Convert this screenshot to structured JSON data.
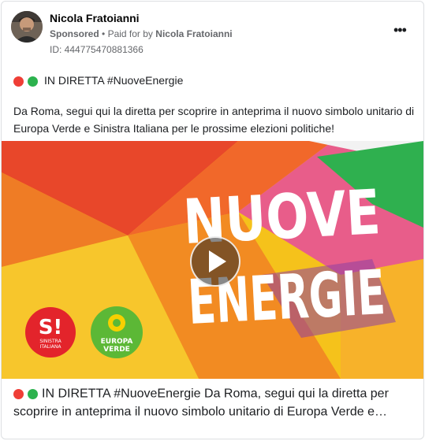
{
  "post": {
    "author_name": "Nicola Fratoianni",
    "sponsored_label": "Sponsored",
    "separator": "•",
    "paid_prefix": "Paid for by",
    "paid_by": "Nicola Fratoianni",
    "ad_id": "ID: 444775470881366",
    "more_label": "•••",
    "tagline": "IN DIRETTA #NuoveEnergie",
    "body": "Da Roma, segui qui la diretta per scoprire in anteprima il nuovo simbolo unitario di Europa Verde e Sinistra Italiana per le prossime elezioni politiche!",
    "footer_text": "IN DIRETTA #NuoveEnergie Da Roma, segui qui la diretta per scoprire in anteprima il nuovo simbolo unitario di Europa Verde e…"
  },
  "media": {
    "headline_line1": "NUOVE",
    "headline_line2": "ENERGIE",
    "logo_left_text1": "SINISTRA",
    "logo_left_text2": "ITALIANA",
    "logo_right_text1": "EUROPA",
    "logo_right_text2": "VERDE",
    "play_icon": "play-icon"
  },
  "colors": {
    "dot_red": "#ef3e36",
    "dot_green": "#2cb24e"
  }
}
